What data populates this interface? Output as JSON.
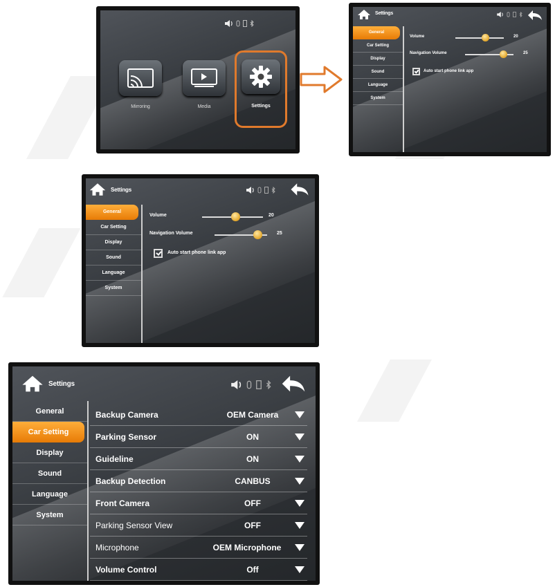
{
  "screen1": {
    "status_icons": [
      "speaker-icon",
      "usb-icon",
      "phone-icon",
      "bluetooth-icon"
    ],
    "apps": [
      {
        "label": "Mirroring",
        "icon": "mirroring-icon"
      },
      {
        "label": "Media",
        "icon": "media-icon"
      },
      {
        "label": "Settings",
        "icon": "gear-icon"
      }
    ],
    "highlight_color": "#e07a2c"
  },
  "arrow": {
    "icon": "right-arrow-icon",
    "color": "#e07a2c"
  },
  "settings_general": {
    "title": "Settings",
    "sidebar": [
      "General",
      "Car Setting",
      "Display",
      "Sound",
      "Language",
      "System"
    ],
    "active_index": 0,
    "volume": {
      "label": "Volume",
      "value": "20",
      "fraction": 0.62
    },
    "nav_volume": {
      "label": "Navigation Volume",
      "value": "25",
      "fraction": 0.78
    },
    "auto_start": {
      "label": "Auto start phone link app",
      "checked": true
    }
  },
  "settings_car": {
    "title": "Settings",
    "sidebar": [
      "General",
      "Car Setting",
      "Display",
      "Sound",
      "Language",
      "System"
    ],
    "active_index": 1,
    "rows": [
      {
        "label": "Backup Camera",
        "value": "OEM Camera"
      },
      {
        "label": "Parking Sensor",
        "value": "ON"
      },
      {
        "label": "Guideline",
        "value": "ON"
      },
      {
        "label": "Backup Detection",
        "value": "CANBUS"
      },
      {
        "label": "Front Camera",
        "value": "OFF"
      },
      {
        "label": "Parking Sensor View",
        "value": "OFF"
      },
      {
        "label": "Microphone",
        "value": "OEM Microphone"
      },
      {
        "label": "Volume Control",
        "value": "Off"
      }
    ]
  },
  "colors": {
    "accent": "#f08a12",
    "screen_bg": "#3b3f44"
  }
}
